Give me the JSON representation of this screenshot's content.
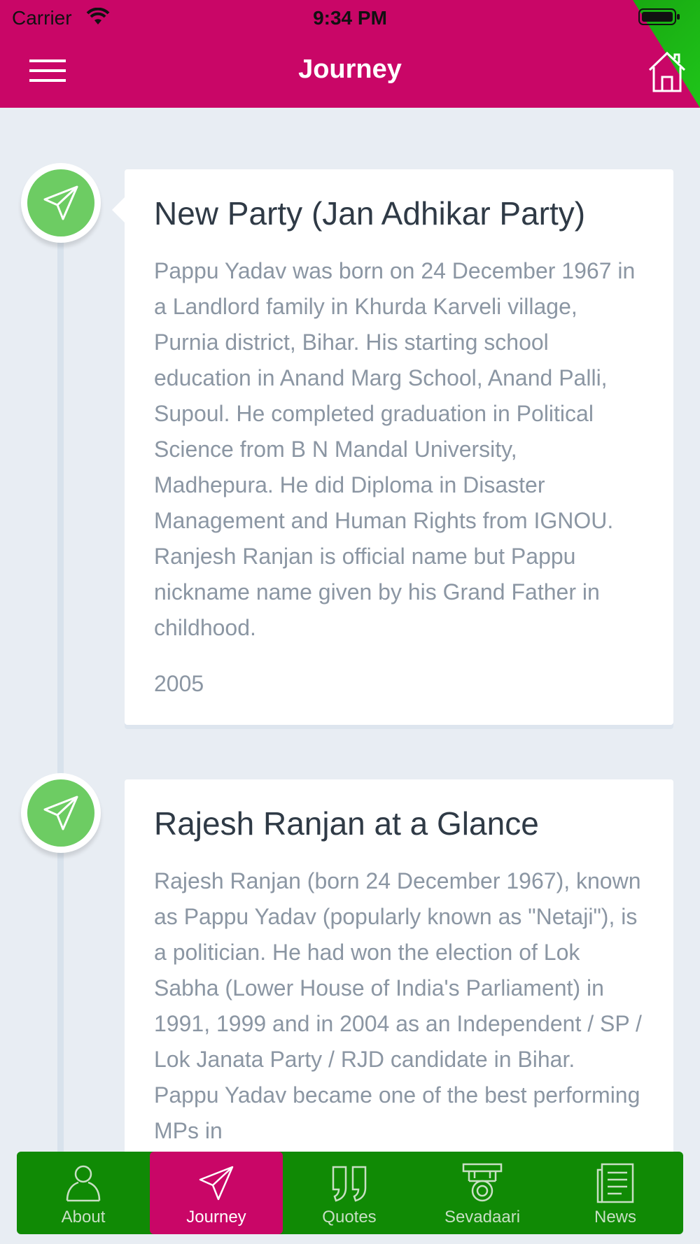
{
  "status_bar": {
    "carrier": "Carrier",
    "time": "9:34 PM"
  },
  "header": {
    "title": "Journey"
  },
  "colors": {
    "header": "#c90667",
    "home_corner": "#1fc51a",
    "tabbar": "#108a05",
    "marker": "#6dcc63"
  },
  "timeline": [
    {
      "title": "New Party (Jan Adhikar Party)",
      "text": "Pappu Yadav was born on 24 December 1967 in a Landlord family in Khurda Karveli village, Purnia district, Bihar. His starting school education in Anand Marg School, Anand Palli, Supoul. He completed graduation in Political Science from B N Mandal University, Madhepura. He did Diploma in Disaster Management and Human Rights from IGNOU. Ranjesh Ranjan is official name but Pappu nickname name given by his Grand Father in childhood.",
      "year": "2005"
    },
    {
      "title": "Rajesh Ranjan at a Glance",
      "text": "Rajesh Ranjan (born 24 December 1967), known as Pappu Yadav (popularly known as \"Netaji\"), is a politician. He had won the election of Lok Sabha (Lower House of India's Parliament) in 1991, 1999 and in 2004 as an Independent / SP / Lok Janata Party / RJD candidate in Bihar. Pappu Yadav became one of the best performing MPs in"
    }
  ],
  "tabs": [
    {
      "label": "About",
      "icon": "person-icon"
    },
    {
      "label": "Journey",
      "icon": "paper-plane-icon",
      "active": true
    },
    {
      "label": "Quotes",
      "icon": "quote-icon"
    },
    {
      "label": "Sevadaari",
      "icon": "badge-icon"
    },
    {
      "label": "News",
      "icon": "newspaper-icon"
    }
  ]
}
